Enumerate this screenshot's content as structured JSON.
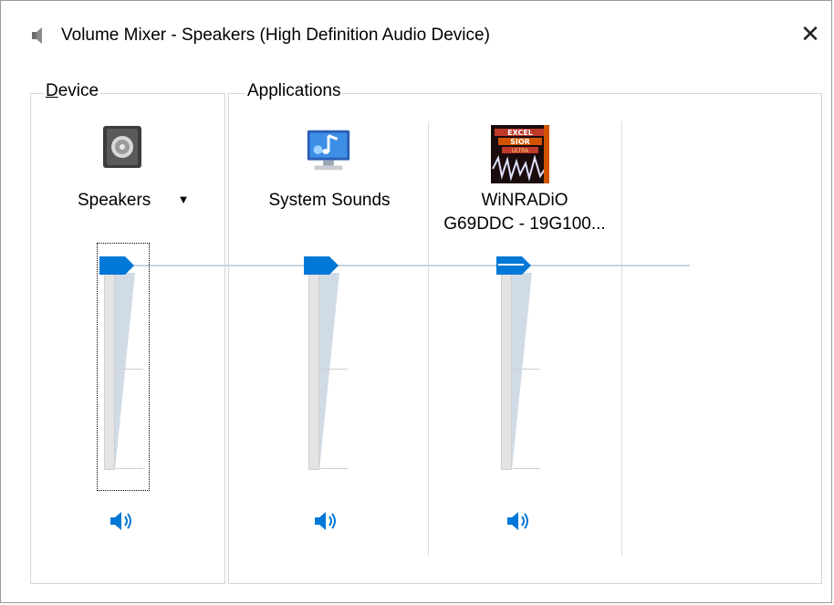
{
  "window": {
    "title": "Volume Mixer - Speakers (High Definition Audio Device)",
    "title_icon": "speaker-icon",
    "close_glyph": "✕"
  },
  "device": {
    "group_label": "Device",
    "mnemonic": "D",
    "name": "Speakers",
    "dropdown_glyph": "▼",
    "icon": "speaker-device-icon",
    "volume": 1.0
  },
  "applications": {
    "group_label": "Applications",
    "items": [
      {
        "name_lines": [
          "System Sounds"
        ],
        "icon": "system-sounds-icon",
        "volume": 1.0
      },
      {
        "name_lines": [
          "WiNRADiO",
          "G69DDC - 19G100..."
        ],
        "icon": "winradio-icon",
        "volume": 1.0
      }
    ]
  },
  "colors": {
    "accent": "#0078d7",
    "track": "#e4e4e4",
    "wedge": "#d1dbe6",
    "peak_line": "#c8d3e0"
  }
}
